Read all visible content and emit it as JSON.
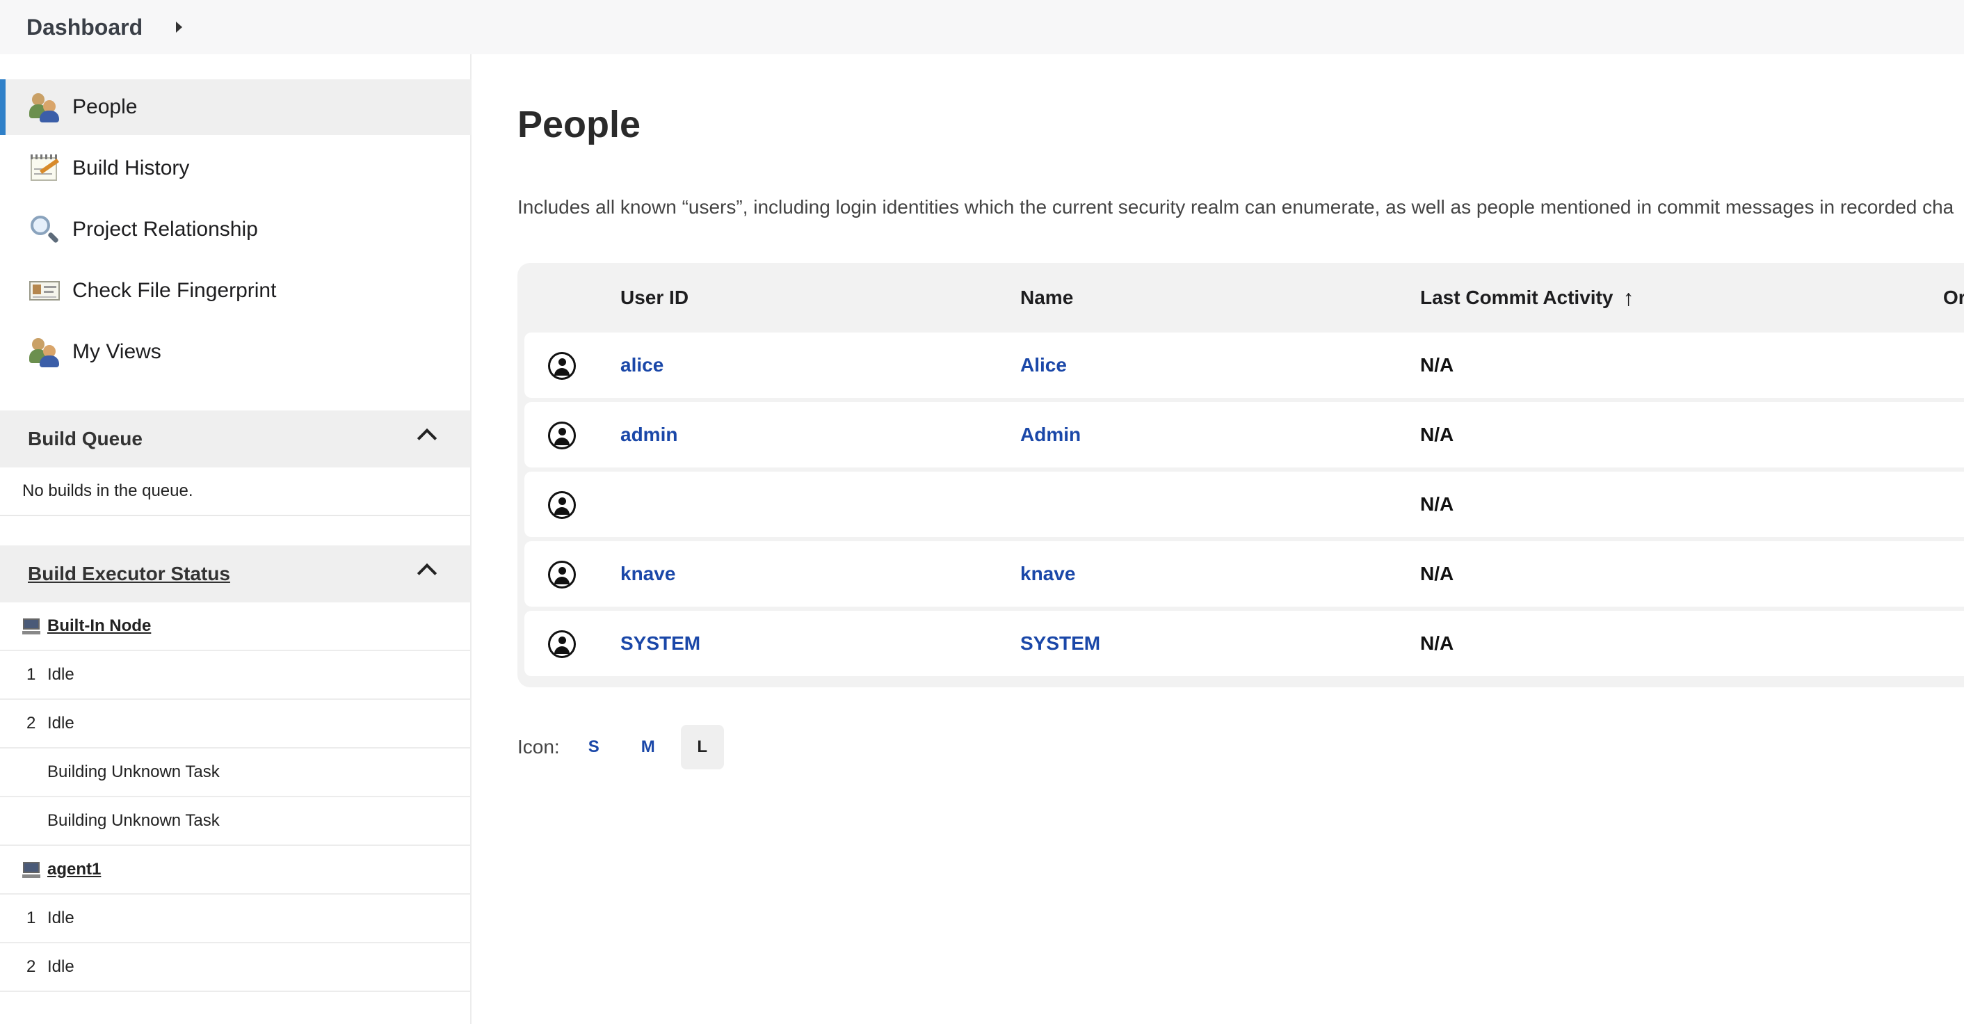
{
  "breadcrumb": {
    "root": "Dashboard"
  },
  "sidebar": {
    "items": [
      {
        "label": "People",
        "icon": "people-icon",
        "active": true
      },
      {
        "label": "Build History",
        "icon": "notepad-icon"
      },
      {
        "label": "Project Relationship",
        "icon": "magnifier-icon"
      },
      {
        "label": "Check File Fingerprint",
        "icon": "fingerprint-card-icon"
      },
      {
        "label": "My Views",
        "icon": "people-icon"
      }
    ],
    "build_queue": {
      "title": "Build Queue",
      "empty_text": "No builds in the queue."
    },
    "executor_status": {
      "title": "Build Executor Status",
      "nodes": [
        {
          "name": "Built-In Node",
          "executors": [
            {
              "num": "1",
              "status": "Idle"
            },
            {
              "num": "2",
              "status": "Idle"
            },
            {
              "num": "",
              "status": "Building Unknown Task"
            },
            {
              "num": "",
              "status": "Building Unknown Task"
            }
          ]
        },
        {
          "name": "agent1",
          "executors": [
            {
              "num": "1",
              "status": "Idle"
            },
            {
              "num": "2",
              "status": "Idle"
            }
          ]
        }
      ]
    }
  },
  "main": {
    "title": "People",
    "description": "Includes all known “users”, including login identities which the current security realm can enumerate, as well as people mentioned in commit messages in recorded cha",
    "table": {
      "headers": {
        "user_id": "User ID",
        "name": "Name",
        "last_commit": "Last Commit Activity",
        "sort_arrow": "↑",
        "on": "Or"
      },
      "rows": [
        {
          "user_id": "alice",
          "name": "Alice",
          "activity": "N/A"
        },
        {
          "user_id": "admin",
          "name": "Admin",
          "activity": "N/A"
        },
        {
          "user_id": "",
          "name": "",
          "activity": "N/A"
        },
        {
          "user_id": "knave",
          "name": "knave",
          "activity": "N/A"
        },
        {
          "user_id": "SYSTEM",
          "name": "SYSTEM",
          "activity": "N/A"
        }
      ]
    },
    "icon_size": {
      "label": "Icon:",
      "options": [
        "S",
        "M",
        "L"
      ],
      "selected": "L"
    }
  },
  "colors": {
    "link": "#1a47a8",
    "active_accent": "#2f80c8"
  }
}
